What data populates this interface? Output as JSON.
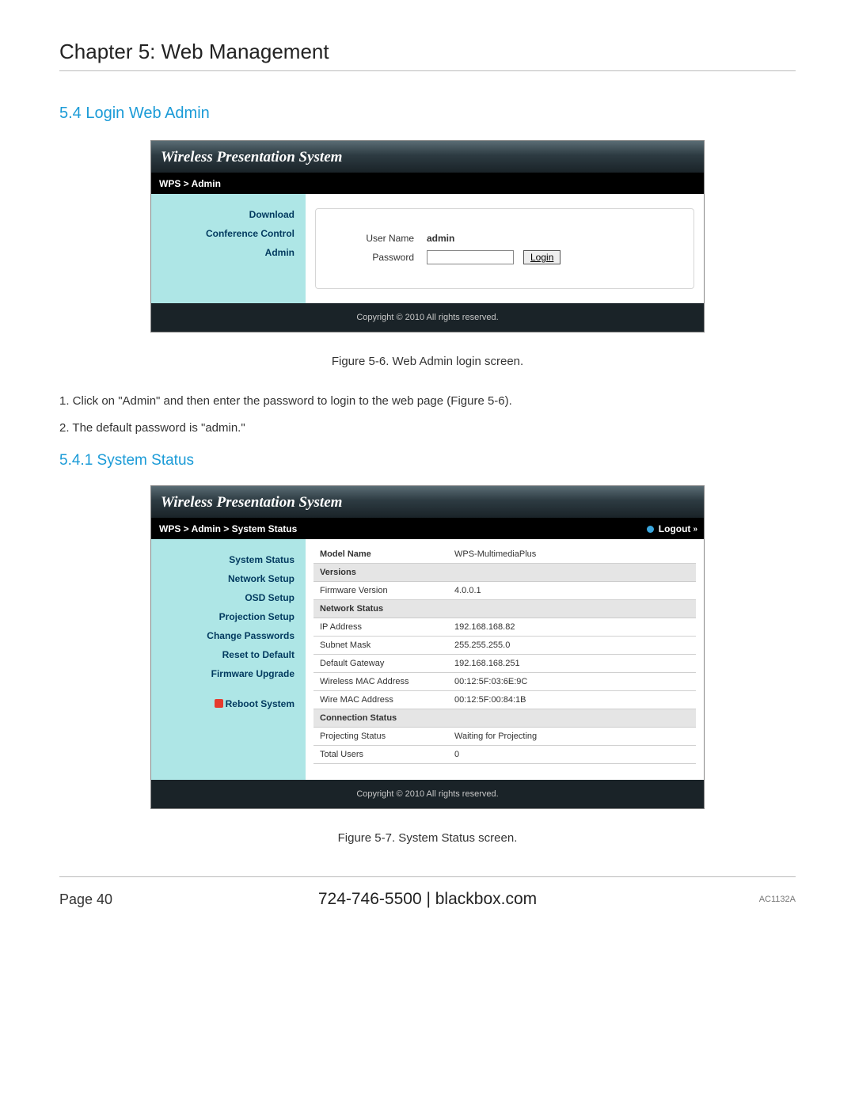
{
  "chapter_title": "Chapter 5: Web Management",
  "section_5_4": "5.4 Login Web Admin",
  "section_5_4_1": "5.4.1 System Status",
  "app_title": "Wireless Presentation System",
  "fig1": {
    "breadcrumb": "WPS > Admin",
    "sidebar": [
      "Download",
      "Conference Control",
      "Admin"
    ],
    "login": {
      "username_label": "User Name",
      "username_value": "admin",
      "password_label": "Password",
      "password_value": "",
      "login_btn": "Login"
    },
    "copyright": "Copyright © 2010 All rights reserved.",
    "caption": "Figure 5-6. Web Admin login screen."
  },
  "instructions": [
    "1. Click on \"Admin\" and then enter the password to login to the web page (Figure 5-6).",
    "2. The default password is \"admin.\""
  ],
  "fig2": {
    "breadcrumb": "WPS > Admin > System Status",
    "logout_label": "Logout",
    "sidebar_main": [
      "System Status",
      "Network Setup",
      "OSD Setup",
      "Projection Setup",
      "Change Passwords",
      "Reset to Default",
      "Firmware Upgrade"
    ],
    "sidebar_reboot": "Reboot System",
    "rows": [
      {
        "type": "data",
        "label": "Model Name",
        "value": "WPS-MultimediaPlus"
      },
      {
        "type": "section",
        "label": "Versions"
      },
      {
        "type": "data",
        "label": "Firmware Version",
        "value": "4.0.0.1"
      },
      {
        "type": "section",
        "label": "Network Status"
      },
      {
        "type": "data",
        "label": "IP Address",
        "value": "192.168.168.82"
      },
      {
        "type": "data",
        "label": "Subnet Mask",
        "value": "255.255.255.0"
      },
      {
        "type": "data",
        "label": "Default Gateway",
        "value": "192.168.168.251"
      },
      {
        "type": "data",
        "label": "Wireless MAC Address",
        "value": "00:12:5F:03:6E:9C"
      },
      {
        "type": "data",
        "label": "Wire MAC Address",
        "value": "00:12:5F:00:84:1B"
      },
      {
        "type": "section",
        "label": "Connection Status"
      },
      {
        "type": "data",
        "label": "Projecting Status",
        "value": "Waiting for Projecting"
      },
      {
        "type": "data",
        "label": "Total Users",
        "value": "0"
      }
    ],
    "copyright": "Copyright © 2010 All rights reserved.",
    "caption": "Figure 5-7. System Status screen."
  },
  "footer": {
    "page": "Page 40",
    "phone": "724-746-5500",
    "sep": "   |   ",
    "site": "blackbox.com",
    "model": "AC1132A"
  }
}
